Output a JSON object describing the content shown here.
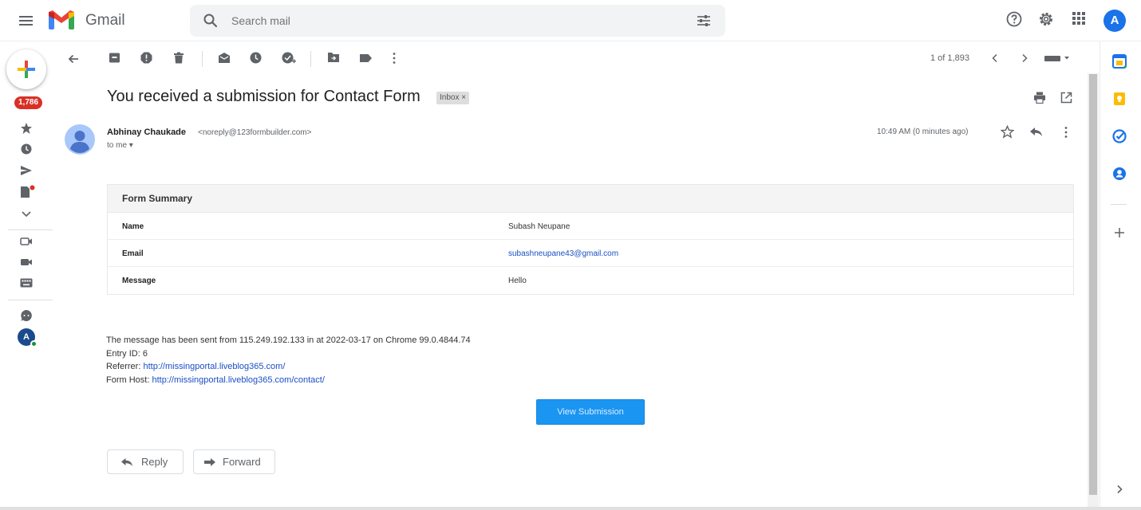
{
  "app": {
    "name": "Gmail",
    "search_placeholder": "Search mail",
    "account_initial": "A"
  },
  "rail": {
    "unread_count": "1,786"
  },
  "toolbar": {
    "pager": "1 of 1,893"
  },
  "message": {
    "subject": "You received a submission for Contact Form",
    "label": "Inbox ×",
    "sender_name": "Abhinay Chaukade",
    "sender_email": "<noreply@123formbuilder.com>",
    "to": "to me ▾",
    "time": "10:49 AM (0 minutes ago)"
  },
  "form_summary": {
    "title": "Form Summary",
    "rows": [
      {
        "label": "Name",
        "value": "Subash Neupane"
      },
      {
        "label": "Email",
        "value": "subashneupane43@gmail.com"
      },
      {
        "label": "Message",
        "value": "Hello"
      }
    ]
  },
  "meta": {
    "sent_line": "The message has been sent from 115.249.192.133 in at 2022-03-17 on Chrome 99.0.4844.74",
    "entry_id": "Entry ID: 6",
    "referrer_label": "Referrer:",
    "referrer_url": "http://missingportal.liveblog365.com/",
    "form_host_label": "Form Host:",
    "form_host_url": "http://missingportal.liveblog365.com/contact/"
  },
  "buttons": {
    "view_submission": "View Submission",
    "reply": "Reply",
    "forward": "Forward"
  },
  "colors": {
    "accent": "#1a73e8",
    "badge": "#d93025",
    "view_button": "#1b95f2"
  }
}
